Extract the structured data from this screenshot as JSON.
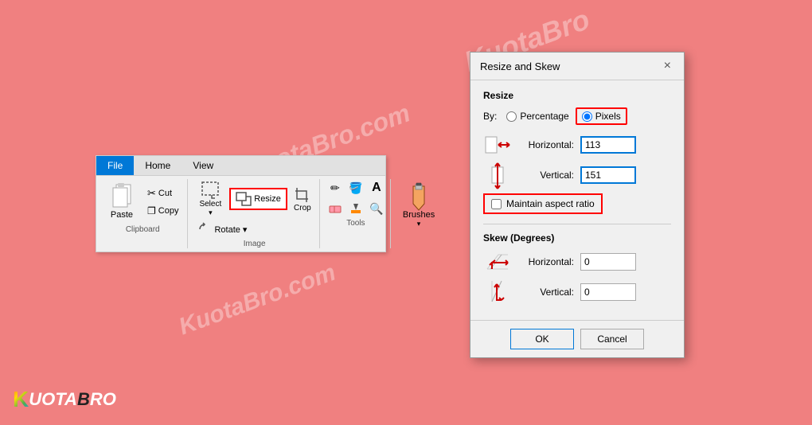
{
  "background": "#f08080",
  "watermarks": [
    "KuotaBro.com",
    "KuotaBro.com",
    "KuotaBro.com"
  ],
  "ribbon": {
    "tabs": [
      "File",
      "Home",
      "View"
    ],
    "active_tab": "File",
    "sections": {
      "clipboard": {
        "label": "Clipboard",
        "paste": "Paste",
        "cut": "Cut",
        "copy": "Copy"
      },
      "image": {
        "label": "Image",
        "select": "Select",
        "resize": "Resize",
        "crop": "Crop",
        "rotate": "Rotate ▾"
      },
      "tools": {
        "label": "Tools"
      },
      "brushes": {
        "label": "Brushes",
        "text": "Brushes"
      }
    }
  },
  "dialog": {
    "title": "Resize and Skew",
    "close_label": "×",
    "resize_section": "Resize",
    "by_label": "By:",
    "percentage_label": "Percentage",
    "pixels_label": "Pixels",
    "horizontal_label": "Horizontal:",
    "horizontal_value": "113",
    "vertical_label": "Vertical:",
    "vertical_value": "151",
    "maintain_aspect_label": "Maintain aspect ratio",
    "skew_section": "Skew (Degrees)",
    "skew_horizontal_label": "Horizontal:",
    "skew_horizontal_value": "0",
    "skew_vertical_label": "Vertical:",
    "skew_vertical_value": "0",
    "ok_label": "OK",
    "cancel_label": "Cancel"
  },
  "logo": {
    "k": "K",
    "rest": "UOTABRO"
  }
}
